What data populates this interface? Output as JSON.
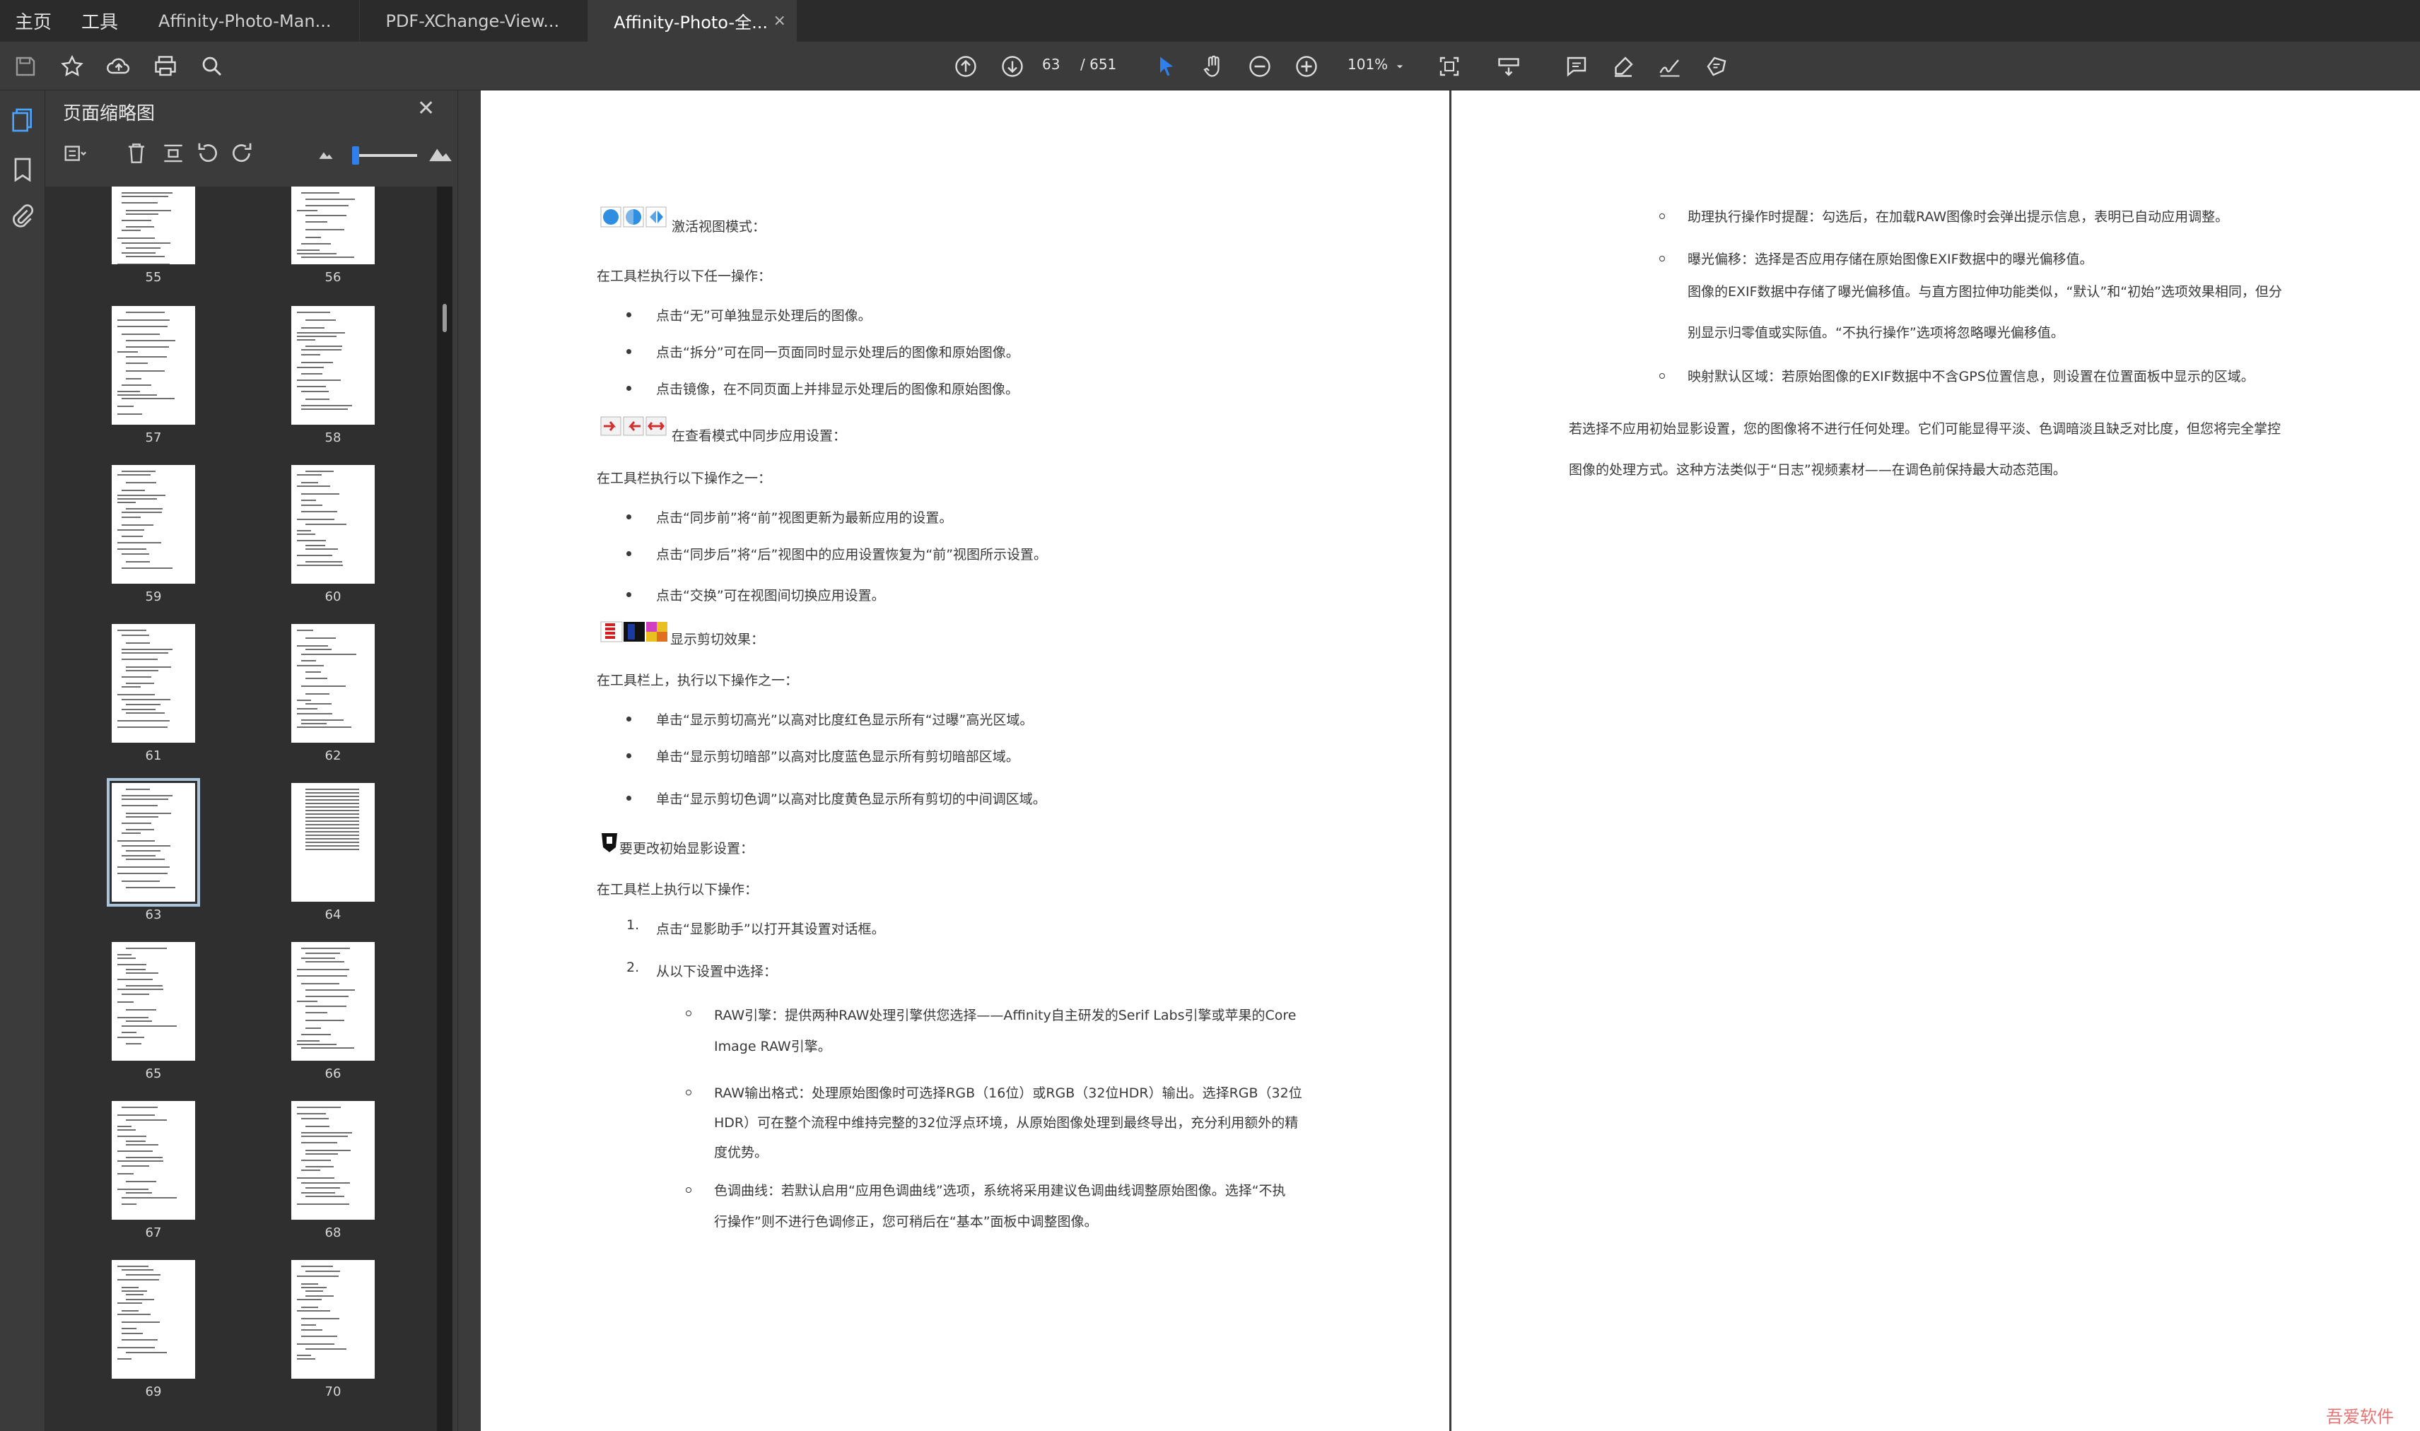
{
  "menu": {
    "home": "主页",
    "tools": "工具"
  },
  "tabs": [
    {
      "label": "Affinity-Photo-Man..."
    },
    {
      "label": "PDF-XChange-View..."
    },
    {
      "label": "Affinity-Photo-全...",
      "close": "×"
    }
  ],
  "toolbar": {
    "current_page": "63",
    "total_pages": "/ 651",
    "zoom": "101%"
  },
  "panel": {
    "title": "页面缩略图",
    "close": "✕"
  },
  "thumbnails": [
    {
      "page": "55"
    },
    {
      "page": "56"
    },
    {
      "page": "57"
    },
    {
      "page": "58"
    },
    {
      "page": "59"
    },
    {
      "page": "60"
    },
    {
      "page": "61"
    },
    {
      "page": "62"
    },
    {
      "page": "63",
      "selected": true
    },
    {
      "page": "64"
    },
    {
      "page": "65"
    },
    {
      "page": "66"
    },
    {
      "page": "67"
    },
    {
      "page": "68"
    },
    {
      "page": "69"
    },
    {
      "page": "70"
    }
  ],
  "page_left": {
    "s1_heading": "激活视图模式：",
    "s1_intro": "在工具栏执行以下任一操作：",
    "s1_items": [
      "点击“无”可单独显示处理后的图像。",
      "点击“拆分”可在同一页面同时显示处理后的图像和原始图像。",
      "点击镜像，在不同页面上并排显示处理后的图像和原始图像。"
    ],
    "s2_heading": "在查看模式中同步应用设置：",
    "s2_intro": "在工具栏执行以下操作之一：",
    "s2_items": [
      "点击“同步前”将“前”视图更新为最新应用的设置。",
      "点击“同步后”将“后”视图中的应用设置恢复为“前”视图所示设置。",
      "点击“交换”可在视图间切换应用设置。"
    ],
    "s3_heading": "显示剪切效果：",
    "s3_intro": "在工具栏上，执行以下操作之一：",
    "s3_items": [
      "单击“显示剪切高光”以高对比度红色显示所有“过曝”高光区域。",
      "单击“显示剪切暗部”以高对比度蓝色显示所有剪切暗部区域。",
      "单击“显示剪切色调”以高对比度黄色显示所有剪切的中间调区域。"
    ],
    "s4_heading": "要更改初始显影设置：",
    "s4_intro": "在工具栏上执行以下操作：",
    "s4_step1_num": "1.",
    "s4_step1": "点击“显影助手”以打开其设置对话框。",
    "s4_step2_num": "2.",
    "s4_step2": "从以下设置中选择：",
    "sub1_l1": "RAW引擎：提供两种RAW处理引擎供您选择——Affinity自主研发的Serif Labs引擎或苹果的Core",
    "sub1_l2": "Image RAW引擎。",
    "sub2_l1": "RAW输出格式：处理原始图像时可选择RGB（16位）或RGB（32位HDR）输出。选择RGB（32位",
    "sub2_l2": "HDR）可在整个流程中维持完整的32位浮点环境，从原始图像处理到最终导出，充分利用额外的精",
    "sub2_l3": "度优势。",
    "sub3_l1": "色调曲线：若默认启用“应用色调曲线”选项，系统将采用建议色调曲线调整原始图像。选择“不执",
    "sub3_l2": "行操作”则不进行色调修正，您可稍后在“基本”面板中调整图像。"
  },
  "page_right": {
    "r1": "助理执行操作时提醒：勾选后，在加载RAW图像时会弹出提示信息，表明已自动应用调整。",
    "r2": "曝光偏移：选择是否应用存储在原始图像EXIF数据中的曝光偏移值。",
    "r2_l2": "图像的EXIF数据中存储了曝光偏移值。与直方图拉伸功能类似，“默认”和“初始”选项效果相同，但分",
    "r2_l3": "别显示归零值或实际值。“不执行操作”选项将忽略曝光偏移值。",
    "r3": "映射默认区域：若原始图像的EXIF数据中不含GPS位置信息，则设置在位置面板中显示的区域。",
    "p1": "若选择不应用初始显影设置，您的图像将不进行任何处理。它们可能显得平淡、色调暗淡且缺乏对比度，但您将完全掌控",
    "p2": "图像的处理方式。这种方法类似于“日志”视频素材——在调色前保持最大动态范围。"
  },
  "watermark": "吾爱软件"
}
